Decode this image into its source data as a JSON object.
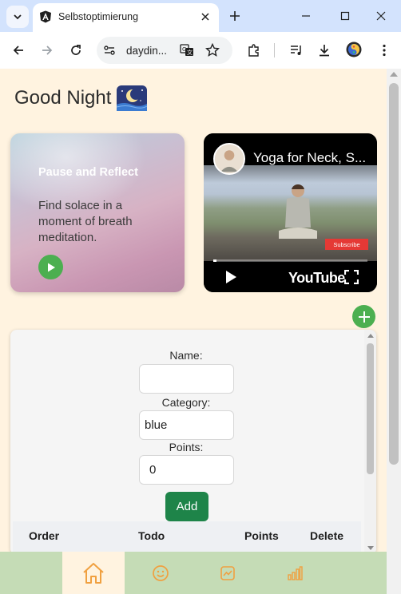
{
  "browser": {
    "tab_title": "Selbstoptimierung",
    "url": "daydin...",
    "colors": {
      "titlebar": "#d3e3fd",
      "toolbar": "#ffffff"
    }
  },
  "page": {
    "greeting": "Good Night",
    "greeting_icon": "moon-night-emoji",
    "reflect_card": {
      "title": "Pause and Reflect",
      "text": "Find solace in a moment of breath meditation.",
      "play_icon": "play-circle-icon"
    },
    "video": {
      "title": "Yoga for Neck, S...",
      "subscribe": "Subscribe",
      "logo": "YouTube",
      "progress": 0.02
    },
    "form": {
      "name_label": "Name:",
      "name_value": "",
      "category_label": "Category:",
      "category_value": "blue",
      "points_label": "Points:",
      "points_value": "0",
      "add_label": "Add"
    },
    "table": {
      "headers": [
        "Order",
        "Todo",
        "Points",
        "Delete"
      ]
    },
    "nav": {
      "items": [
        {
          "icon": "home-icon",
          "active": true
        },
        {
          "icon": "smiley-icon",
          "active": false
        },
        {
          "icon": "chart-line-icon",
          "active": false
        },
        {
          "icon": "bar-chart-icon",
          "active": false
        }
      ],
      "colors": {
        "bar": "#c5dcb6",
        "active": "#fff3e0",
        "icon": "#f0a040"
      }
    }
  }
}
